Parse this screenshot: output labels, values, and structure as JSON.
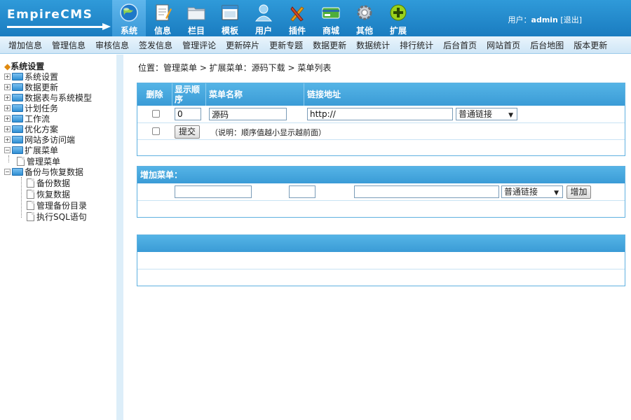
{
  "app": {
    "logo": "EmpireCMS"
  },
  "main_nav": [
    {
      "label": "系统",
      "icon": "globe-icon",
      "active": true
    },
    {
      "label": "信息",
      "icon": "document-pen-icon"
    },
    {
      "label": "栏目",
      "icon": "folder-icon"
    },
    {
      "label": "模板",
      "icon": "window-icon"
    },
    {
      "label": "用户",
      "icon": "user-icon"
    },
    {
      "label": "插件",
      "icon": "tools-icon"
    },
    {
      "label": "商城",
      "icon": "card-icon"
    },
    {
      "label": "其他",
      "icon": "gear-icon"
    },
    {
      "label": "扩展",
      "icon": "plus-circle-icon"
    }
  ],
  "user": {
    "prefix": "用户：",
    "name": "admin",
    "logout": "[退出]"
  },
  "sub_nav": [
    "增加信息",
    "管理信息",
    "审核信息",
    "签发信息",
    "管理评论",
    "更新碎片",
    "更新专题",
    "数据更新",
    "数据统计",
    "排行统计",
    "后台首页",
    "网站首页",
    "后台地图",
    "版本更新"
  ],
  "sidebar": {
    "title": "系统设置",
    "items": [
      {
        "label": "系统设置"
      },
      {
        "label": "数据更新"
      },
      {
        "label": "数据表与系统模型"
      },
      {
        "label": "计划任务"
      },
      {
        "label": "工作流"
      },
      {
        "label": "优化方案"
      },
      {
        "label": "网站多访问端"
      },
      {
        "label": "扩展菜单"
      },
      {
        "label": "管理菜单"
      },
      {
        "label": "备份与恢复数据"
      },
      {
        "label": "备份数据"
      },
      {
        "label": "恢复数据"
      },
      {
        "label": "管理备份目录"
      },
      {
        "label": "执行SQL语句"
      }
    ]
  },
  "breadcrumb": "位置：管理菜单 > 扩展菜单：源码下载 > 菜单列表",
  "table": {
    "headers": {
      "delete": "删除",
      "order": "显示顺序",
      "name": "菜单名称",
      "url": "链接地址"
    },
    "row": {
      "order": "0",
      "name": "源码",
      "url": "http://",
      "type": "普通链接"
    },
    "submit_label": "提交",
    "note": "（说明：顺序值越小显示越前面）"
  },
  "add_menu": {
    "title": "增加菜单：",
    "type": "普通链接",
    "add_label": "增加"
  }
}
